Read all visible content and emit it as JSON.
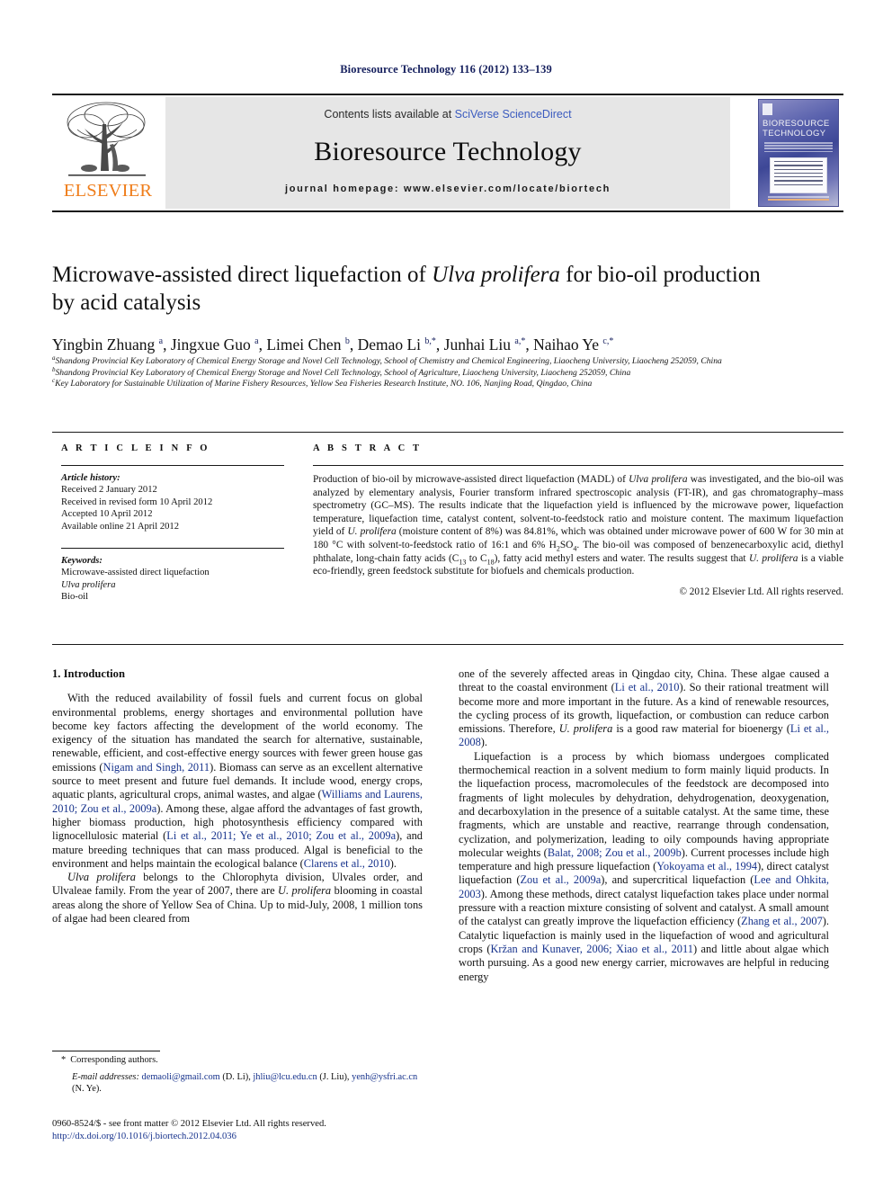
{
  "running_head": "Bioresource Technology 116 (2012) 133–139",
  "masthead": {
    "contents_prefix": "Contents lists available at ",
    "sciencedirect_link": "SciVerse ScienceDirect",
    "journal_name": "Bioresource Technology",
    "homepage_label": "journal homepage: www.elsevier.com/locate/biortech",
    "publisher_name": "ELSEVIER",
    "cover_title": "BIORESOURCE TECHNOLOGY"
  },
  "article": {
    "title_line1_a": "Microwave-assisted direct liquefaction of ",
    "title_italic": "Ulva prolifera",
    "title_line1_b": " for bio-oil production",
    "title_line2": "by acid catalysis",
    "authors_html": "Yingbin Zhuang <sup>a</sup>, Jingxue Guo <sup>a</sup>, Limei Chen <sup>b</sup>, Demao Li <sup>b,*</sup>, Junhai Liu <sup>a,*</sup>, Naihao Ye <sup>c,*</sup>",
    "affiliations": [
      "Shandong Provincial Key Laboratory of Chemical Energy Storage and Novel Cell Technology, School of Chemistry and Chemical Engineering, Liaocheng University, Liaocheng 252059, China",
      "Shandong Provincial Key Laboratory of Chemical Energy Storage and Novel Cell Technology, School of Agriculture, Liaocheng University, Liaocheng 252059, China",
      "Key Laboratory for Sustainable Utilization of Marine Fishery Resources, Yellow Sea Fisheries Research Institute, NO. 106, Nanjing Road, Qingdao, China"
    ],
    "affiliation_marks": [
      "a",
      "b",
      "c"
    ]
  },
  "article_info": {
    "heading": "A R T I C L E    I N F O",
    "history_label": "Article history:",
    "history": [
      "Received 2 January 2012",
      "Received in revised form 10 April 2012",
      "Accepted 10 April 2012",
      "Available online 21 April 2012"
    ],
    "keywords_label": "Keywords:",
    "keywords": [
      "Microwave-assisted direct liquefaction",
      "Ulva prolifera",
      "Bio-oil"
    ]
  },
  "abstract": {
    "heading": "A B S T R A C T",
    "copyright": "© 2012 Elsevier Ltd. All rights reserved."
  },
  "introduction": {
    "section_title": "1. Introduction"
  },
  "footnotes": {
    "corresponding": "Corresponding authors.",
    "star": "*",
    "email_label": "E-mail addresses:",
    "emails": [
      {
        "address": "demaoli@gmail.com",
        "person": " (D. Li), "
      },
      {
        "address": "jhliu@lcu.edu.cn",
        "person": " (J. Liu), "
      },
      {
        "address": "yenh@ysfri.ac.cn",
        "person": " (N. Ye)."
      }
    ]
  },
  "imprint": {
    "line1": "0960-8524/$ - see front matter © 2012 Elsevier Ltd. All rights reserved.",
    "doi": "http://dx.doi.org/10.1016/j.biortech.2012.04.036"
  },
  "colors": {
    "link_blue": "#3b5bbf",
    "citation_blue": "#16328c",
    "elsevier_orange": "#ef7d1a",
    "running_head_navy": "#16205e",
    "banner_gray": "#e6e6e6"
  }
}
